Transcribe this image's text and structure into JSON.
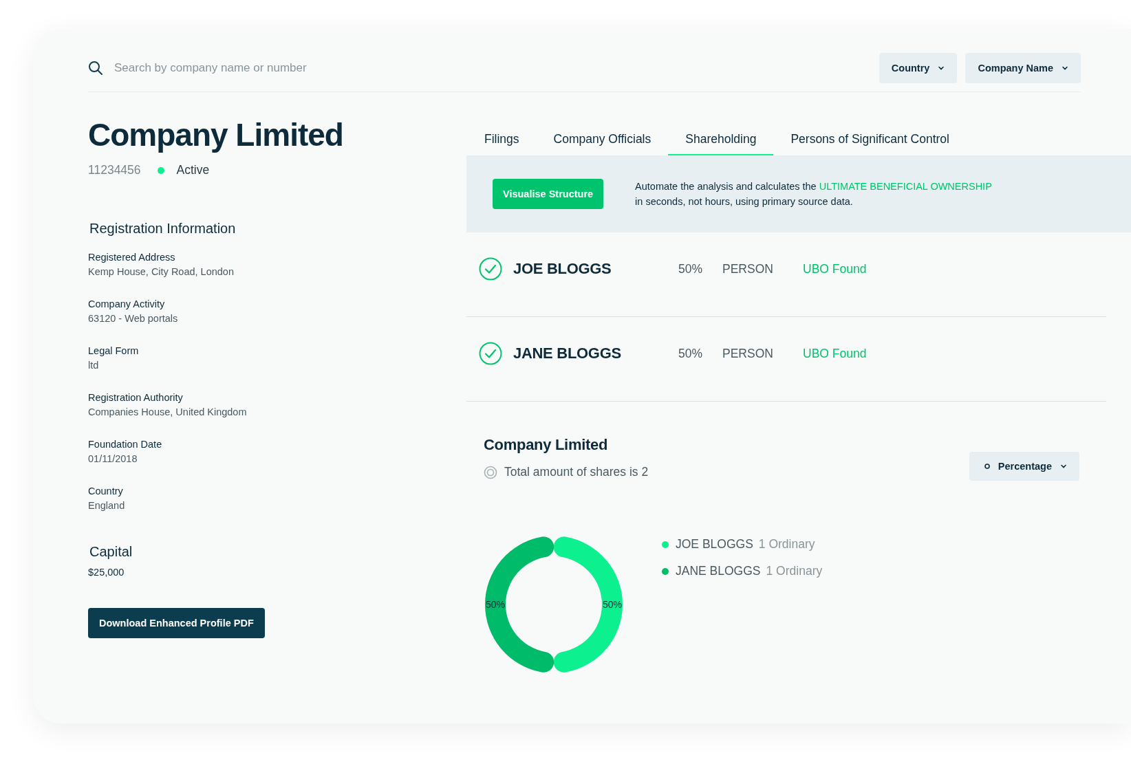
{
  "search": {
    "placeholder": "Search by company name or number"
  },
  "filters": [
    {
      "label": "Country"
    },
    {
      "label": "Company Name"
    }
  ],
  "company": {
    "name": "Company Limited",
    "number": "11234456",
    "status": "Active"
  },
  "registration": {
    "title": "Registration Information",
    "fields": [
      {
        "label": "Registered Address",
        "value": "Kemp House, City Road, London"
      },
      {
        "label": "Company Activity",
        "value": "63120 - Web portals"
      },
      {
        "label": "Legal Form",
        "value": "ltd"
      },
      {
        "label": "Registration Authority",
        "value": "Companies House, United Kingdom"
      },
      {
        "label": "Foundation Date",
        "value": "01/11/2018"
      },
      {
        "label": "Country",
        "value": "England"
      }
    ]
  },
  "capital": {
    "title": "Capital",
    "value": "$25,000"
  },
  "download_button": "Download Enhanced Profile PDF",
  "tabs": [
    {
      "label": "Filings",
      "selected": false
    },
    {
      "label": "Company Officials",
      "selected": false
    },
    {
      "label": "Shareholding",
      "selected": true
    },
    {
      "label": "Persons of Significant Control",
      "selected": false
    }
  ],
  "banner": {
    "button": "Visualise Structure",
    "text": "Automate the analysis and calculates the **ULTIMATE BENEFICIAL OWNERSHIP**\nin seconds, not hours, using primary source data."
  },
  "shareholders": [
    {
      "name": "JOE BLOGGS",
      "share": "50%",
      "type": "PERSON",
      "status": "UBO Found"
    },
    {
      "name": "JANE BLOGGS",
      "share": "50%",
      "type": "PERSON",
      "status": "UBO Found"
    }
  ],
  "structure": {
    "title": "Company Limited",
    "total": "Total amount of shares is 2",
    "view": {
      "label": "Percentage"
    },
    "legend": [
      {
        "detail": "1 Ordinary",
        "color": "#0df08f"
      },
      {
        "detail": "1 Ordinary",
        "color": "#00bb6a"
      }
    ],
    "chart_data": {
      "type": "donut",
      "categories": [
        "JOE BLOGGS",
        "JANE BLOGGS"
      ],
      "values": [
        50,
        50
      ],
      "value_labels": [
        "50%",
        "50%"
      ]
    }
  }
}
